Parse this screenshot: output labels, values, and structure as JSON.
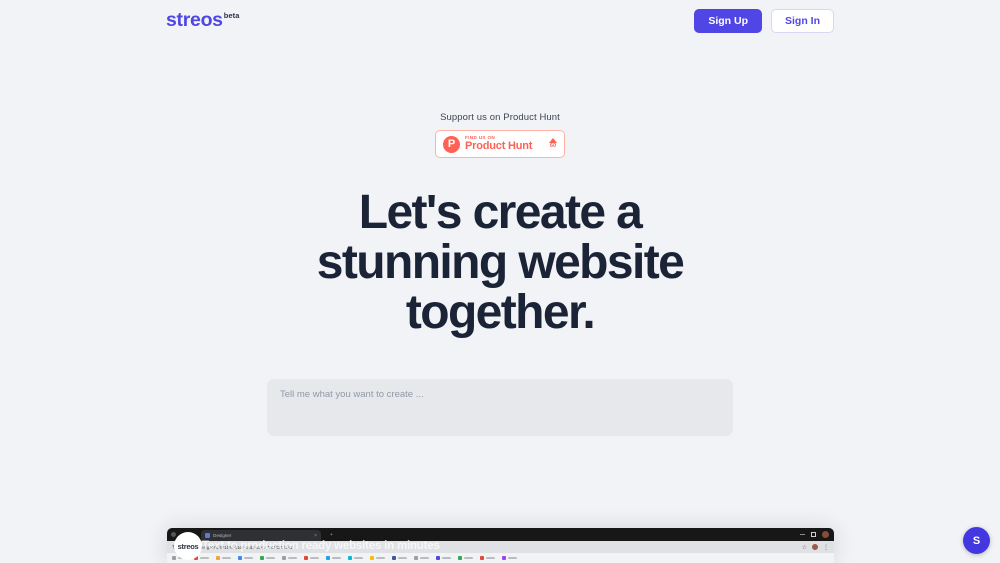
{
  "brand": {
    "name": "streos",
    "badge": "beta",
    "accent_color": "#5046e5"
  },
  "header": {
    "sign_up_label": "Sign Up",
    "sign_in_label": "Sign In"
  },
  "hero": {
    "product_hunt_label": "Support us on Product Hunt",
    "product_hunt_badge": {
      "mark": "P",
      "kicker": "FIND US ON",
      "name": "Product Hunt",
      "votes": "60",
      "color": "#ff6154"
    },
    "headline": "Let's create a stunning website together."
  },
  "prompt": {
    "placeholder": "Tell me what you want to create ...",
    "value": ""
  },
  "demo": {
    "overlay_title": "Text to production ready websites in minutes",
    "logo_badge": "streos",
    "browser": {
      "tab_title": "Designer",
      "tab_close": "×",
      "new_tab": "+",
      "reload_icon": "↻",
      "menu_icon": "⋮",
      "star_icon": "☆",
      "url": "streos.io/designer/d4fe1b5c-b1ec-4ad2-a5e1-7ac1621 f1a1f"
    }
  },
  "chat": {
    "fab_label": "S"
  }
}
